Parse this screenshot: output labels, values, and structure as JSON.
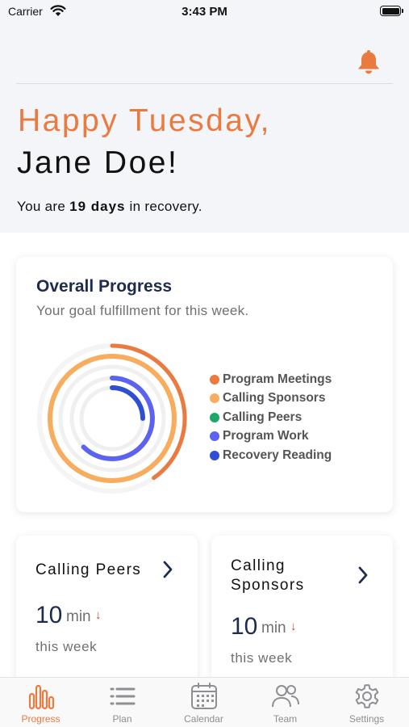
{
  "status_bar": {
    "carrier": "Carrier",
    "time": "3:43 PM"
  },
  "header": {
    "greeting": "Happy Tuesday,",
    "name": "Jane Doe!",
    "recovery_prefix": "You are ",
    "recovery_days": "19 days",
    "recovery_suffix": " in recovery."
  },
  "overall_progress": {
    "title": "Overall Progress",
    "subtitle": "Your goal fulfillment for this week.",
    "legend": [
      {
        "label": "Program Meetings",
        "color": "#ea7a3d"
      },
      {
        "label": "Calling Sponsors",
        "color": "#f7ac5e"
      },
      {
        "label": "Calling Peers",
        "color": "#1fa66a"
      },
      {
        "label": "Program Work",
        "color": "#5b63f0"
      },
      {
        "label": "Recovery Reading",
        "color": "#2f4ed2"
      }
    ]
  },
  "stats": [
    {
      "title": "Calling Peers",
      "value": "10",
      "unit": "min",
      "trend": "↓",
      "period": "this week"
    },
    {
      "title": "Calling Sponsors",
      "value": "10",
      "unit": "min",
      "trend": "↓",
      "period": "this week"
    }
  ],
  "tabs": [
    {
      "label": "Progress",
      "icon": "bar-chart-icon",
      "active": true
    },
    {
      "label": "Plan",
      "icon": "list-icon",
      "active": false
    },
    {
      "label": "Calendar",
      "icon": "calendar-icon",
      "active": false
    },
    {
      "label": "Team",
      "icon": "team-icon",
      "active": false
    },
    {
      "label": "Settings",
      "icon": "gear-icon",
      "active": false
    }
  ],
  "colors": {
    "accent": "#ea7a3d",
    "navy": "#1e2b4d",
    "trend_down": "#e0343b"
  }
}
